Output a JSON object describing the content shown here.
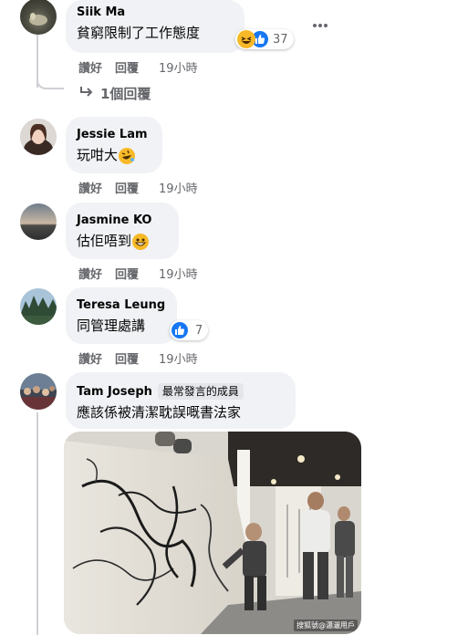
{
  "comments": [
    {
      "author": "Siik Ma",
      "text": "貧窮限制了工作態度",
      "reaction_count": "37",
      "like": "讚好",
      "reply": "回覆",
      "time": "19小時"
    },
    {
      "author": "Jessie Lam",
      "text": "玩咁大",
      "like": "讚好",
      "reply": "回覆",
      "time": "19小時"
    },
    {
      "author": "Jasmine KO",
      "text": "估佢唔到",
      "like": "讚好",
      "reply": "回覆",
      "time": "19小時"
    },
    {
      "author": "Teresa Leung",
      "text": "同管理處講",
      "reaction_count": "7",
      "like": "讚好",
      "reply": "回覆",
      "time": "19小時"
    },
    {
      "author": "Tam Joseph",
      "badge": "最常發言的成員",
      "text": "應該係被清潔耽誤嘅書法家"
    }
  ],
  "replies_link": "1個回覆",
  "image_watermark": "搜狐號@瀟灑用戶",
  "colors": {
    "bubble": "#f0f2f5",
    "meta": "#65676b",
    "like_blue": "#1877f2"
  }
}
